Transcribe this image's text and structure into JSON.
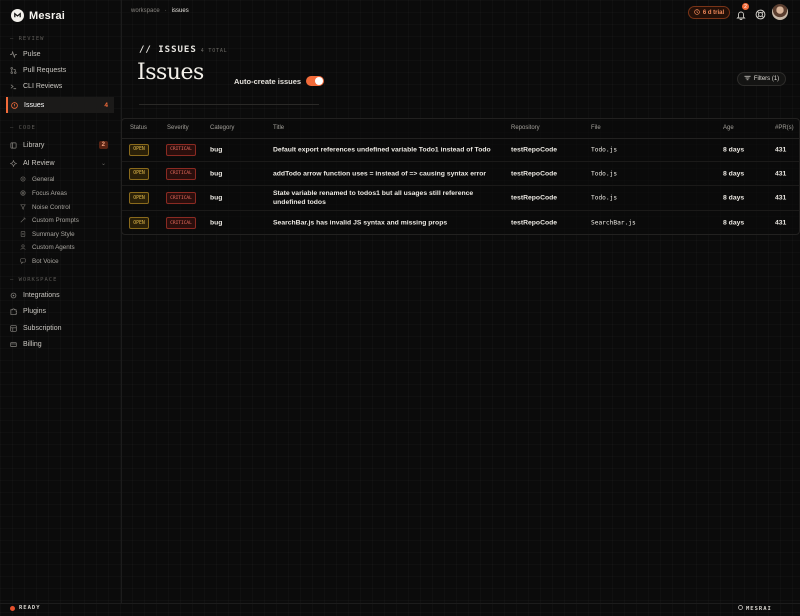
{
  "brand": {
    "name": "Mesrai"
  },
  "sidebar": {
    "sections": {
      "review": "REVIEW",
      "code": "CODE",
      "workspace": "WORKSPACE"
    },
    "review_items": [
      {
        "label": "Pulse",
        "icon": "pulse-icon"
      },
      {
        "label": "Pull Requests",
        "icon": "pull-request-icon"
      },
      {
        "label": "CLI Reviews",
        "icon": "terminal-icon"
      },
      {
        "label": "Issues",
        "icon": "alert-icon",
        "count": "4",
        "active": true
      }
    ],
    "code_items": [
      {
        "label": "Library",
        "icon": "book-icon",
        "count": "2"
      },
      {
        "label": "AI Review",
        "icon": "ai-icon",
        "expanded": true
      }
    ],
    "ai_review_sub": [
      {
        "label": "General",
        "icon": "gear-icon"
      },
      {
        "label": "Focus Areas",
        "icon": "target-icon"
      },
      {
        "label": "Noise Control",
        "icon": "filter-icon"
      },
      {
        "label": "Custom Prompts",
        "icon": "wand-icon"
      },
      {
        "label": "Summary Style",
        "icon": "document-icon"
      },
      {
        "label": "Custom Agents",
        "icon": "agent-icon"
      },
      {
        "label": "Bot Voice",
        "icon": "chat-icon"
      }
    ],
    "workspace_items": [
      {
        "label": "Integrations",
        "icon": "plug-icon"
      },
      {
        "label": "Plugins",
        "icon": "puzzle-icon"
      },
      {
        "label": "Subscription",
        "icon": "card-icon"
      },
      {
        "label": "Billing",
        "icon": "wallet-icon"
      }
    ]
  },
  "topbar": {
    "breadcrumb": [
      "workspace",
      "issues"
    ],
    "trial_label": "6 d trial",
    "notification_count": "2"
  },
  "header": {
    "kicker": "// ISSUES",
    "total": "4 TOTAL",
    "title": "Issues",
    "auto_create_label": "Auto-create issues",
    "auto_create_on": true,
    "filters_label": "Filters (1)"
  },
  "table": {
    "columns": [
      "Status",
      "Severity",
      "Category",
      "Title",
      "Repository",
      "File",
      "Age",
      "#PR(s)"
    ],
    "rows": [
      {
        "status": "OPEN",
        "severity": "CRITICAL",
        "category": "bug",
        "title": "Default export references undefined variable Todo1 instead of Todo",
        "repository": "testRepoCode",
        "file": "Todo.js",
        "age": "8 days",
        "pr": "431"
      },
      {
        "status": "OPEN",
        "severity": "CRITICAL",
        "category": "bug",
        "title": "addTodo arrow function uses = instead of => causing syntax error",
        "repository": "testRepoCode",
        "file": "Todo.js",
        "age": "8 days",
        "pr": "431"
      },
      {
        "status": "OPEN",
        "severity": "CRITICAL",
        "category": "bug",
        "title": "State variable renamed to todos1 but all usages still reference undefined todos",
        "repository": "testRepoCode",
        "file": "Todo.js",
        "age": "8 days",
        "pr": "431"
      },
      {
        "status": "OPEN",
        "severity": "CRITICAL",
        "category": "bug",
        "title": "SearchBar.js has invalid JS syntax and missing props",
        "repository": "testRepoCode",
        "file": "SearchBar.js",
        "age": "8 days",
        "pr": "431"
      }
    ]
  },
  "footer": {
    "status": "READY",
    "brand": "MESRAI"
  },
  "colors": {
    "accent": "#f26b3a",
    "open": "#e1b84a",
    "critical": "#ec6d5f",
    "bg": "#0b0b0b"
  }
}
